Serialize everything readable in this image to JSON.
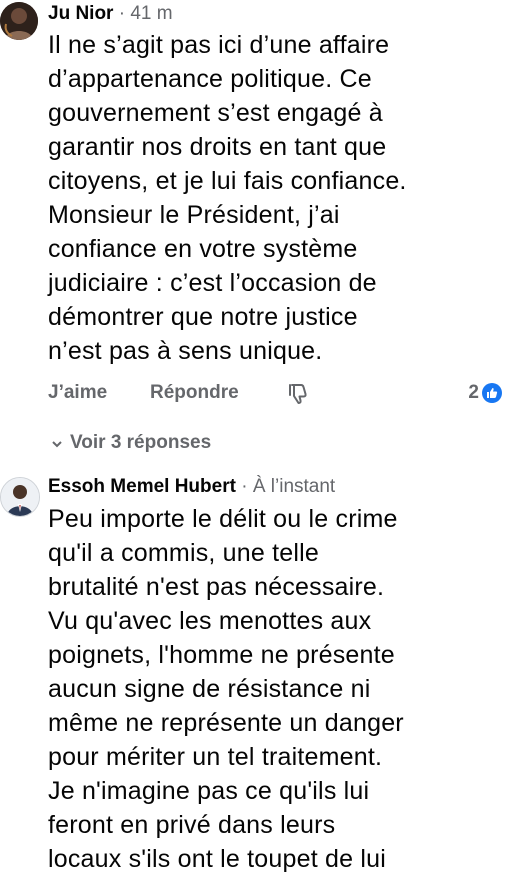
{
  "comments": [
    {
      "author": "Ju Nior",
      "separator": "·",
      "time": "41 m",
      "lines": [
        "Il ne s’agit pas ici d’une affaire",
        "d’appartenance politique. Ce",
        "gouvernement s’est engagé à",
        "garantir nos droits en tant que",
        "citoyens, et je lui fais confiance.",
        "Monsieur le Président, j’ai",
        "confiance en votre système",
        "judiciaire : c’est l’occasion de",
        "démontrer que notre justice",
        "n’est pas à sens unique."
      ],
      "actions": {
        "like": "J’aime",
        "reply": "Répondre"
      },
      "icons": {
        "dislike": "thumbs-down-icon",
        "reaction": "like-reaction-icon"
      },
      "reaction_count": "2",
      "view_replies": "Voir 3 réponses"
    },
    {
      "author": "Essoh Memel Hubert",
      "separator": "·",
      "time": "À l’instant",
      "lines": [
        "Peu importe le délit ou le crime",
        "qu'il a commis, une telle",
        "brutalité n'est pas nécessaire.",
        "Vu qu'avec les menottes aux",
        "poignets, l'homme ne présente",
        "aucun signe de résistance ni",
        "même ne représente un danger",
        "pour mériter un tel traitement.",
        "Je n'imagine pas ce qu'ils lui",
        "feront en privé dans leurs",
        "locaux s'ils ont le toupet de lui"
      ]
    }
  ],
  "colors": {
    "link_blue": "#1877f2",
    "meta_gray": "#65676b",
    "text": "#050505"
  }
}
